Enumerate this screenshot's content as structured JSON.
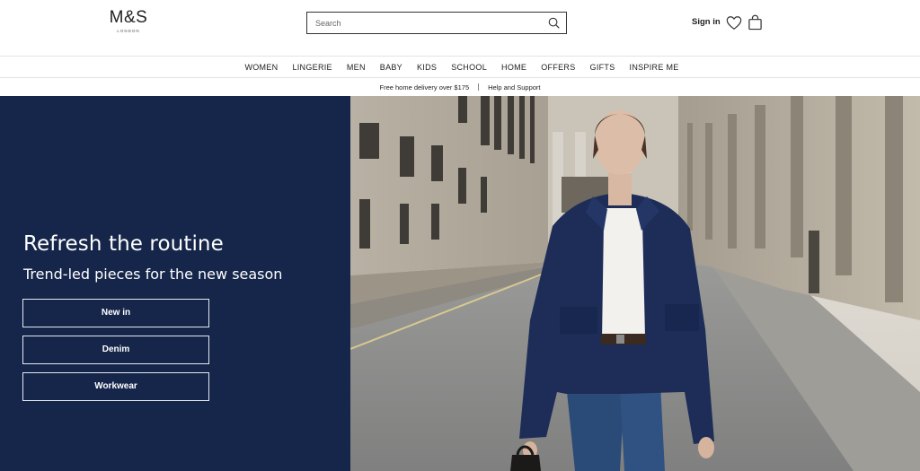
{
  "header": {
    "logo_main": "M&S",
    "logo_sub": "LONDON",
    "search_placeholder": "Search",
    "signin_label": "Sign in"
  },
  "nav": {
    "items": [
      "WOMEN",
      "LINGERIE",
      "MEN",
      "BABY",
      "KIDS",
      "SCHOOL",
      "HOME",
      "OFFERS",
      "GIFTS",
      "INSPIRE ME"
    ]
  },
  "infobar": {
    "delivery": "Free home delivery over $175",
    "help": "Help and Support"
  },
  "hero": {
    "title": "Refresh the routine",
    "subtitle": "Trend-led pieces for the new season",
    "buttons": [
      "New in",
      "Denim",
      "Workwear"
    ]
  },
  "icons": {
    "search": "search-icon",
    "wishlist": "heart-icon",
    "bag": "shopping-bag-icon"
  },
  "colors": {
    "panel": "#15264a",
    "text_dark": "#222222",
    "border": "#e3e3e3"
  }
}
